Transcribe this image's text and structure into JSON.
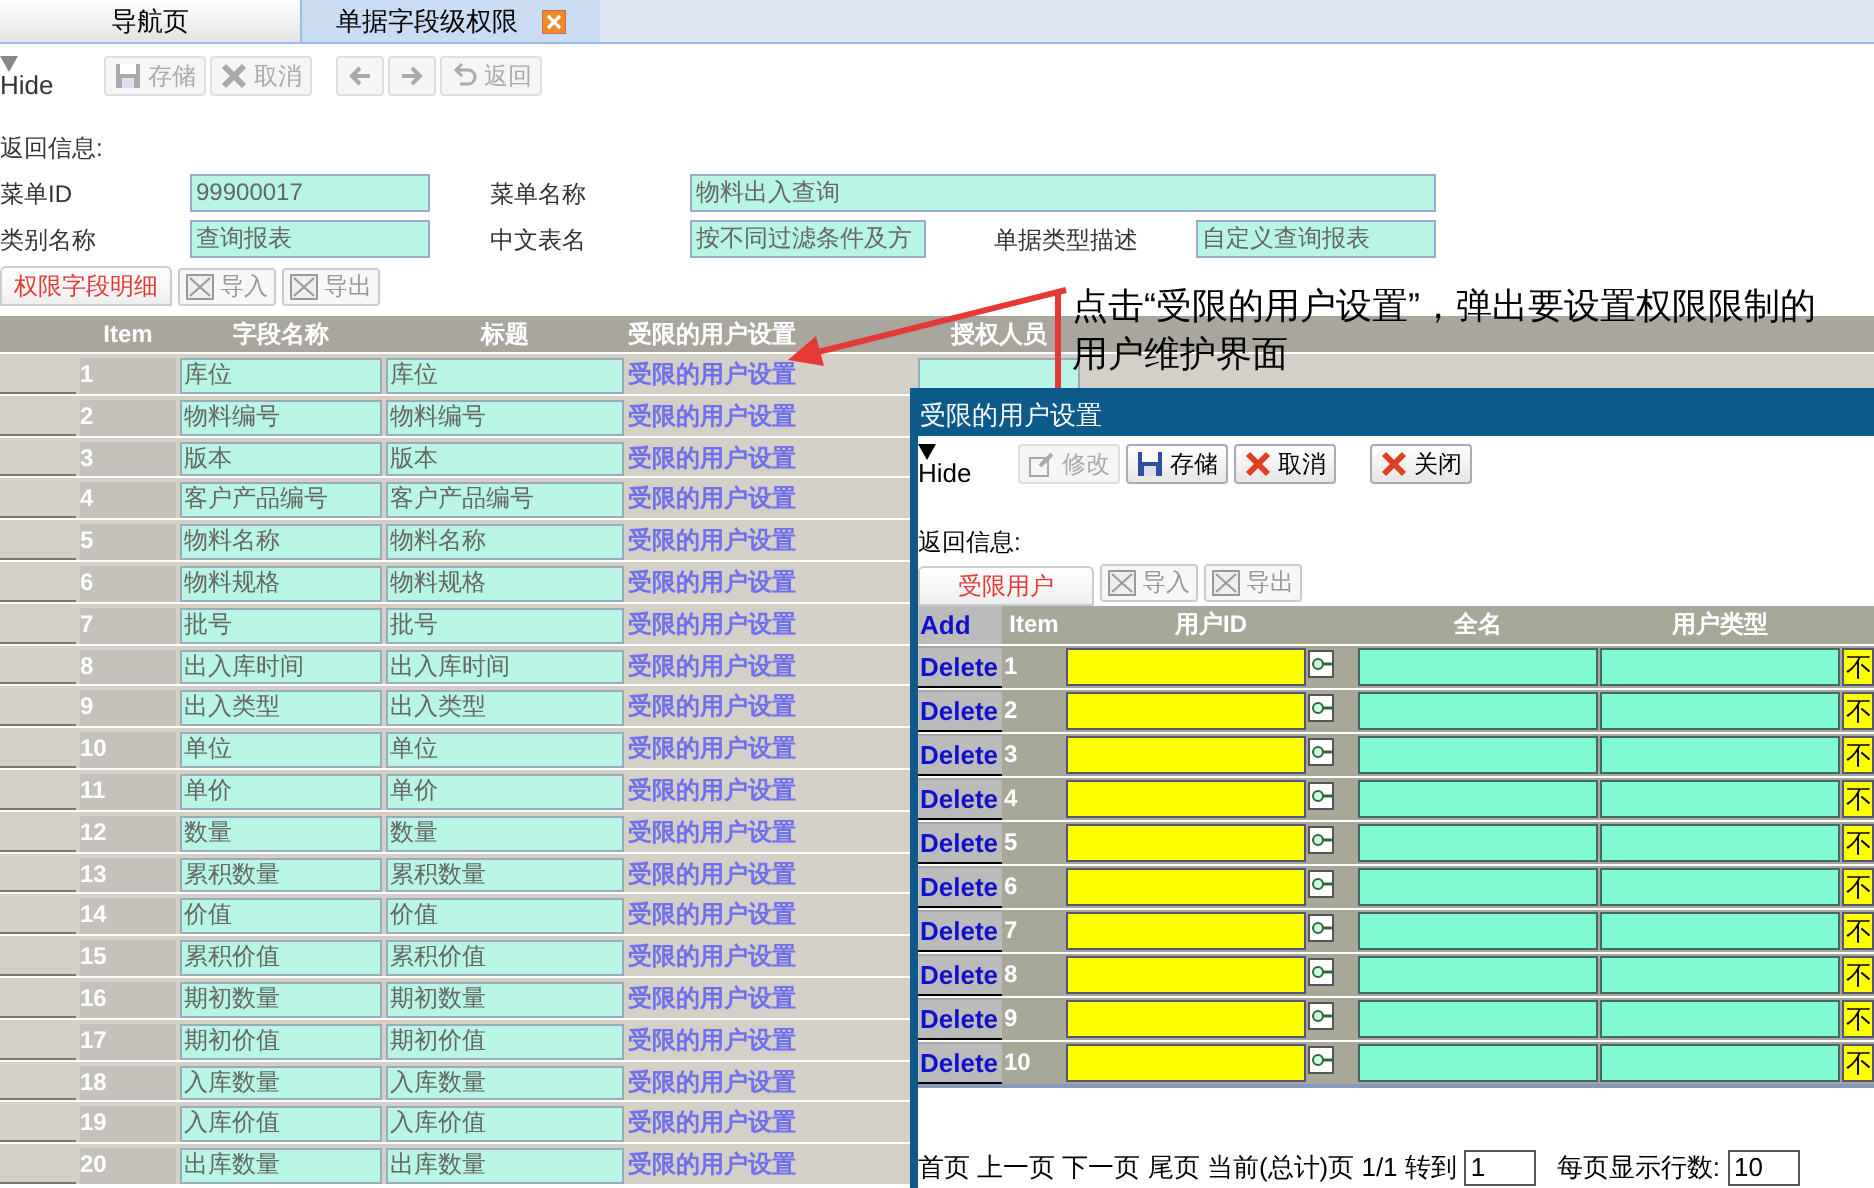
{
  "tabs": [
    {
      "label": "导航页",
      "selected": false,
      "closable": false
    },
    {
      "label": "单据字段级权限",
      "selected": true,
      "closable": true
    }
  ],
  "toolbar": {
    "hide_label": "Hide",
    "buttons": [
      {
        "label": "存储",
        "kind": "save",
        "disabled": true
      },
      {
        "label": "取消",
        "kind": "cancel",
        "disabled": true
      },
      {
        "kind": "left",
        "disabled": true
      },
      {
        "kind": "right",
        "disabled": true
      },
      {
        "label": "返回",
        "kind": "return",
        "disabled": true
      }
    ]
  },
  "return_info": "返回信息:",
  "form_rows": [
    [
      {
        "label": "菜单ID",
        "value": "99900017"
      },
      {
        "label": "菜单名称",
        "value": "物料出入查询"
      }
    ],
    [
      {
        "label": "类别名称",
        "value": "查询报表"
      },
      {
        "label": "中文表名",
        "value": "按不同过滤条件及方"
      },
      {
        "label": "单据类型描述",
        "value": "自定义查询报表"
      }
    ]
  ],
  "detail_tab": {
    "label": "权限字段明细",
    "selected": true
  },
  "detail_actions": [
    {
      "label": "导入",
      "disabled": true
    },
    {
      "label": "导出",
      "disabled": true
    }
  ],
  "table": {
    "columns": [
      "Item",
      "字段名称",
      "标题",
      "受限的用户设置",
      "授权人员"
    ],
    "rows": [
      {
        "item": "1",
        "field_name": "库位",
        "title": "库位",
        "link": "受限的用户设置"
      },
      {
        "item": "2",
        "field_name": "物料编号",
        "title": "物料编号",
        "link": "受限的用户设置"
      },
      {
        "item": "3",
        "field_name": "版本",
        "title": "版本",
        "link": "受限的用户设置"
      },
      {
        "item": "4",
        "field_name": "客户产品编号",
        "title": "客户产品编号",
        "link": "受限的用户设置"
      },
      {
        "item": "5",
        "field_name": "物料名称",
        "title": "物料名称",
        "link": "受限的用户设置"
      },
      {
        "item": "6",
        "field_name": "物料规格",
        "title": "物料规格",
        "link": "受限的用户设置"
      },
      {
        "item": "7",
        "field_name": "批号",
        "title": "批号",
        "link": "受限的用户设置"
      },
      {
        "item": "8",
        "field_name": "出入库时间",
        "title": "出入库时间",
        "link": "受限的用户设置"
      },
      {
        "item": "9",
        "field_name": "出入类型",
        "title": "出入类型",
        "link": "受限的用户设置"
      },
      {
        "item": "10",
        "field_name": "单位",
        "title": "单位",
        "link": "受限的用户设置"
      },
      {
        "item": "11",
        "field_name": "单价",
        "title": "单价",
        "link": "受限的用户设置"
      },
      {
        "item": "12",
        "field_name": "数量",
        "title": "数量",
        "link": "受限的用户设置"
      },
      {
        "item": "13",
        "field_name": "累积数量",
        "title": "累积数量",
        "link": "受限的用户设置"
      },
      {
        "item": "14",
        "field_name": "价值",
        "title": "价值",
        "link": "受限的用户设置"
      },
      {
        "item": "15",
        "field_name": "累积价值",
        "title": "累积价值",
        "link": "受限的用户设置"
      },
      {
        "item": "16",
        "field_name": "期初数量",
        "title": "期初数量",
        "link": "受限的用户设置"
      },
      {
        "item": "17",
        "field_name": "期初价值",
        "title": "期初价值",
        "link": "受限的用户设置"
      },
      {
        "item": "18",
        "field_name": "入库数量",
        "title": "入库数量",
        "link": "受限的用户设置"
      },
      {
        "item": "19",
        "field_name": "入库价值",
        "title": "入库价值",
        "link": "受限的用户设置"
      },
      {
        "item": "20",
        "field_name": "出库数量",
        "title": "出库数量",
        "link": "受限的用户设置"
      }
    ]
  },
  "annotation": "点击“受限的用户设置”，弹出要设置权限限制的用户维护界面",
  "dialog": {
    "title": "受限的用户设置",
    "hide_label": "Hide",
    "buttons": [
      {
        "label": "修改",
        "kind": "edit",
        "disabled": true
      },
      {
        "label": "存储",
        "kind": "save",
        "disabled": false
      },
      {
        "label": "取消",
        "kind": "cancel",
        "disabled": false
      },
      {
        "label": "关闭",
        "kind": "cancel",
        "disabled": false
      }
    ],
    "return_info": "返回信息:",
    "tab": {
      "label": "受限用户",
      "selected": true
    },
    "actions": [
      {
        "label": "导入",
        "disabled": true
      },
      {
        "label": "导出",
        "disabled": true
      }
    ],
    "grid": {
      "add_label": "Add",
      "columns": [
        "Item",
        "用户ID",
        "全名",
        "用户类型"
      ],
      "rows": [
        {
          "action": "Delete",
          "item": "1",
          "column_7": "不"
        },
        {
          "action": "Delete",
          "item": "2",
          "column_7": "不"
        },
        {
          "action": "Delete",
          "item": "3",
          "column_7": "不"
        },
        {
          "action": "Delete",
          "item": "4",
          "column_7": "不"
        },
        {
          "action": "Delete",
          "item": "5",
          "column_7": "不"
        },
        {
          "action": "Delete",
          "item": "6",
          "column_7": "不"
        },
        {
          "action": "Delete",
          "item": "7",
          "column_7": "不"
        },
        {
          "action": "Delete",
          "item": "8",
          "column_7": "不"
        },
        {
          "action": "Delete",
          "item": "9",
          "column_7": "不"
        },
        {
          "action": "Delete",
          "item": "10",
          "column_7": "不"
        }
      ]
    },
    "pager": {
      "text": "首页 上一页 下一页 尾页 当前(总计)页 1/1 转到",
      "page": "1",
      "rows_label": "每页显示行数:",
      "rows_per_page": "10"
    }
  }
}
